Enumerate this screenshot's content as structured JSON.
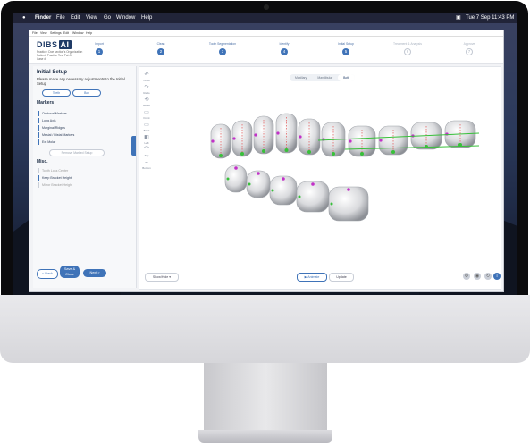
{
  "menubar": {
    "apple": "",
    "app": "Finder",
    "items": [
      "File",
      "Edit",
      "View",
      "Go",
      "Window",
      "Help"
    ],
    "datetime": "Tue 7 Sep  11:43 PM"
  },
  "app_menu": [
    "File",
    "View",
    "Settings",
    "Edit",
    "Window",
    "Help"
  ],
  "header": {
    "logo_text": "DIBS",
    "logo_ai": "AI",
    "patient_lines": [
      "Practice: Doe section's Organization",
      "Patient: Practice Test Pat JJ",
      "Case #"
    ],
    "steps": [
      {
        "label": "Import",
        "num": "1",
        "active": true
      },
      {
        "label": "Clean",
        "num": "2",
        "active": true
      },
      {
        "label": "Tooth Segmentation",
        "num": "3",
        "active": true
      },
      {
        "label": "Identify",
        "num": "4",
        "active": true
      },
      {
        "label": "Initial Setup",
        "num": "5",
        "active": true
      },
      {
        "label": "Treatment & Analysis",
        "num": "6",
        "active": false
      },
      {
        "label": "Approve",
        "num": "7",
        "active": false
      }
    ]
  },
  "panel": {
    "title": "Initial Setup",
    "description": "Please make any necessary adjustments to the Initial Setup",
    "toggle_left": "Teeth",
    "toggle_right": "Box",
    "markers_title": "Markers",
    "markers": [
      "Occlusal Markers",
      "Long Axis",
      "Marginal Ridges",
      "Mesial / Distal Markers",
      "Ext Molar"
    ],
    "remove_label": "Remove Marked Setup",
    "misc_title": "Misc.",
    "misc": [
      "Tooth Loss Center",
      "Keep Bracket Height",
      "Mirror Bracket Height"
    ],
    "back": "< Back",
    "save": "Save & Close",
    "next": "Next >"
  },
  "tools": [
    {
      "icon": "undo-icon",
      "glyph": "↶",
      "label": "Undo"
    },
    {
      "icon": "redo-icon",
      "glyph": "↷",
      "label": "Redo"
    },
    {
      "icon": "reset-icon",
      "glyph": "⟲",
      "label": "Reset"
    },
    {
      "icon": "front-view-icon",
      "glyph": "▭",
      "label": "Front"
    },
    {
      "icon": "back-view-icon",
      "glyph": "▭",
      "label": "Back"
    },
    {
      "icon": "left-view-icon",
      "glyph": "◧",
      "label": "Left"
    },
    {
      "icon": "top-view-icon",
      "glyph": "⌒",
      "label": "Top"
    },
    {
      "icon": "bottom-view-icon",
      "glyph": "⌣",
      "label": "Bottom"
    }
  ],
  "view_tabs": [
    "Maxillary",
    "Mandibular",
    "Both"
  ],
  "canvas": {
    "show_hide": "Show/Hide",
    "animate": "Animate",
    "update": "Update"
  },
  "colors": {
    "accent": "#3f73b8",
    "brand": "#1f3b66",
    "marker_green": "#38c03a",
    "marker_magenta": "#c231c8",
    "axis_red": "#e03a3a"
  }
}
